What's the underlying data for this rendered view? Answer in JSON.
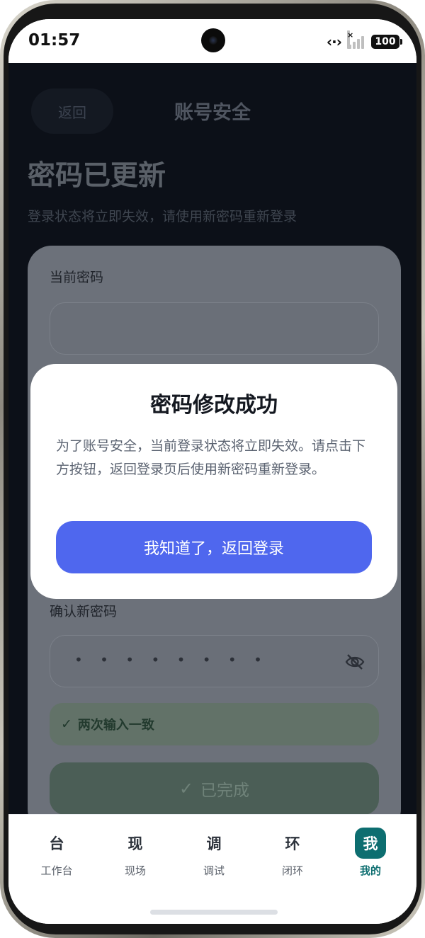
{
  "status_bar": {
    "time": "01:57",
    "network_icon": "dots-arrows-icon",
    "signal_icon": "signal-icon",
    "battery": "100"
  },
  "nav": {
    "back_label": "返回",
    "title": "账号安全"
  },
  "page": {
    "title": "密码已更新",
    "subtitle": "登录状态将立即失效，请使用新密码重新登录"
  },
  "form": {
    "current_password_label": "当前密码",
    "confirm_password_label": "确认新密码",
    "confirm_password_value": "• • • • • • • •",
    "match_hint_check": "✓",
    "match_hint": "两次输入一致",
    "done_check": "✓",
    "done_label": "已完成"
  },
  "modal": {
    "title": "密码修改成功",
    "body": "为了账号安全，当前登录状态将立即失效。请点击下方按钮，返回登录页后使用新密码重新登录。",
    "button_label": "我知道了，返回登录"
  },
  "tabs": [
    {
      "glyph": "台",
      "label": "工作台",
      "active": false
    },
    {
      "glyph": "现",
      "label": "现场",
      "active": false
    },
    {
      "glyph": "调",
      "label": "调试",
      "active": false
    },
    {
      "glyph": "环",
      "label": "闭环",
      "active": false
    },
    {
      "glyph": "我",
      "label": "我的",
      "active": true
    }
  ],
  "colors": {
    "accent": "#4f67ee",
    "active_tab": "#0d6e70",
    "backdrop": "#0c1018"
  }
}
